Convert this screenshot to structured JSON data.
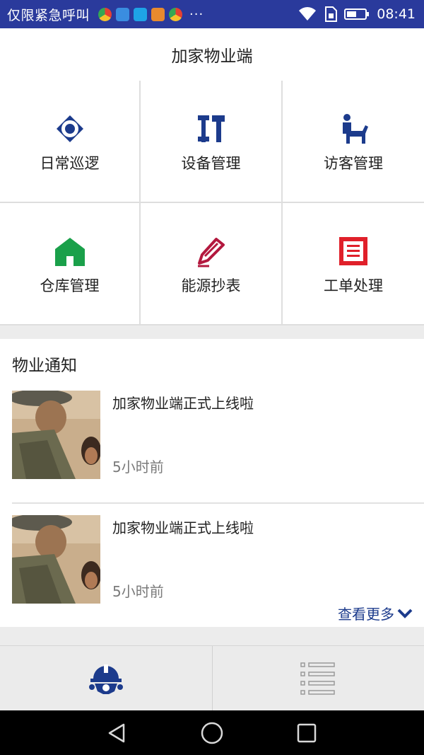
{
  "status_bar": {
    "carrier": "仅限紧急呼叫",
    "more_indicator": "···",
    "time": "08:41",
    "background": "#2a3a9c"
  },
  "header": {
    "title": "加家物业端"
  },
  "menu": {
    "items": [
      {
        "label": "日常巡逻",
        "icon": "eye-icon",
        "color": "#1c3b8c"
      },
      {
        "label": "设备管理",
        "icon": "tools-icon",
        "color": "#1c3b8c"
      },
      {
        "label": "访客管理",
        "icon": "visitor-icon",
        "color": "#1c3b8c"
      },
      {
        "label": "仓库管理",
        "icon": "warehouse-icon",
        "color": "#1aa04a"
      },
      {
        "label": "能源抄表",
        "icon": "pencil-icon",
        "color": "#b3183e"
      },
      {
        "label": "工单处理",
        "icon": "document-icon",
        "color": "#e0202a"
      }
    ]
  },
  "notices": {
    "title": "物业通知",
    "items": [
      {
        "title": "加家物业端正式上线啦",
        "time": "5小时前"
      },
      {
        "title": "加家物业端正式上线啦",
        "time": "5小时前"
      }
    ],
    "more_label": "查看更多"
  },
  "tab_bar": {
    "tabs": [
      {
        "icon": "helmet-gear-icon",
        "active": true,
        "color": "#1c3b8c"
      },
      {
        "icon": "list-icon",
        "active": false,
        "color": "#9a9a9a"
      }
    ]
  }
}
